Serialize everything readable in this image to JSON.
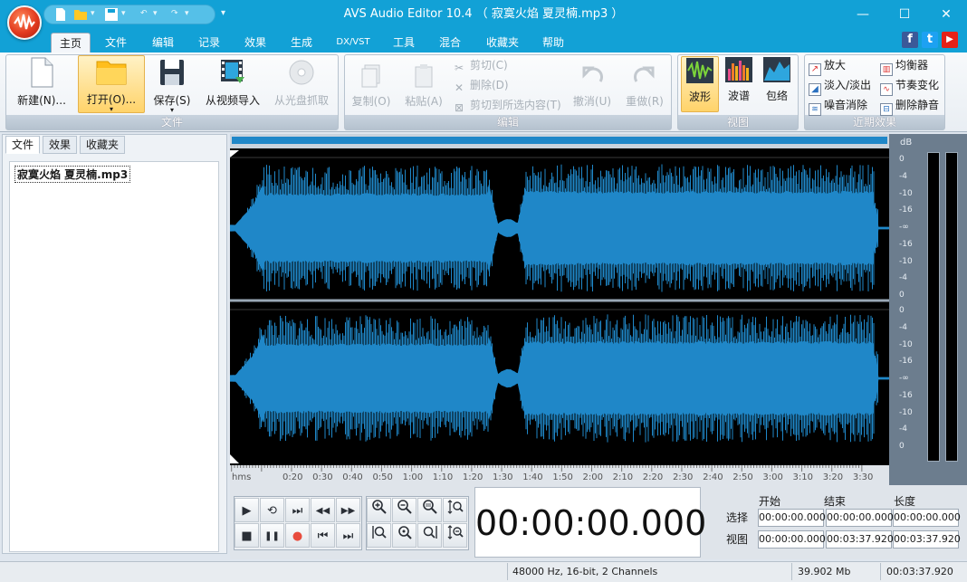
{
  "window": {
    "title": "AVS Audio Editor 10.4 （ 寂寞火焰 夏灵楠.mp3 ）",
    "minimize": "—",
    "maximize": "☐",
    "close": "✕"
  },
  "menu": {
    "tabs": [
      "主页",
      "文件",
      "编辑",
      "记录",
      "效果",
      "生成",
      "DX/VST",
      "工具",
      "混合",
      "收藏夹",
      "帮助"
    ],
    "active": "主页"
  },
  "social": {
    "facebook": "f",
    "twitter": "t",
    "youtube": "▶"
  },
  "ribbon": {
    "file": {
      "label": "文件",
      "new": "新建(N)...",
      "open": "打开(O)...",
      "save": "保存(S)",
      "import_video": "从视频导入",
      "rip_cd": "从光盘抓取"
    },
    "edit": {
      "label": "编辑",
      "copy": "复制(O)",
      "paste": "粘贴(A)",
      "cut": "剪切(C)",
      "delete": "删除(D)",
      "cut_to_selection": "剪切到所选内容(T)",
      "undo": "撤消(U)",
      "redo": "重做(R)"
    },
    "view": {
      "label": "视图",
      "waveform": "波形",
      "spectrum": "波谱",
      "envelope": "包络"
    },
    "recent": {
      "label": "近期效果",
      "amplify": "放大",
      "equalizer": "均衡器",
      "fade": "淡入/淡出",
      "tempo": "节奏变化",
      "noise": "噪音消除",
      "silence": "删除静音"
    }
  },
  "left_panel": {
    "tabs": [
      "文件",
      "效果",
      "收藏夹"
    ],
    "active_tab": "文件",
    "file_item": "寂寞火焰 夏灵楠.mp3"
  },
  "scale": {
    "unit": "dB",
    "labels": [
      "0",
      "-4",
      "-10",
      "-16",
      "-∞",
      "-16",
      "-10",
      "-4",
      "0"
    ]
  },
  "timeline": {
    "unit": "hms",
    "ticks": [
      "0:20",
      "0:30",
      "0:40",
      "0:50",
      "1:00",
      "1:10",
      "1:20",
      "1:30",
      "1:40",
      "1:50",
      "2:00",
      "2:10",
      "2:20",
      "2:30",
      "2:40",
      "2:50",
      "3:00",
      "3:10",
      "3:20",
      "3:30"
    ]
  },
  "transport": {
    "play": "▶",
    "loop": "⟲",
    "play_to_end": "⏭",
    "rewind": "◀◀",
    "forward": "▶▶",
    "stop": "■",
    "pause": "❚❚",
    "record": "●",
    "go_start": "⏮",
    "go_end": "⏭"
  },
  "timecode": "00:00:00.000",
  "selection": {
    "headers": [
      "开始",
      "结束",
      "长度"
    ],
    "rows": [
      {
        "label": "选择",
        "values": [
          "00:00:00.000",
          "00:00:00.000",
          "00:00:00.000"
        ]
      },
      {
        "label": "视图",
        "values": [
          "00:00:00.000",
          "00:03:37.920",
          "00:03:37.920"
        ]
      }
    ]
  },
  "status": {
    "format": "48000 Hz, 16-bit, 2 Channels",
    "size": "39.902 Mb",
    "duration": "00:03:37.920"
  },
  "colors": {
    "titlebar": "#12a1d6",
    "waveform": "#1f87c8",
    "wave_background": "#000000",
    "record": "#e84c3d"
  }
}
